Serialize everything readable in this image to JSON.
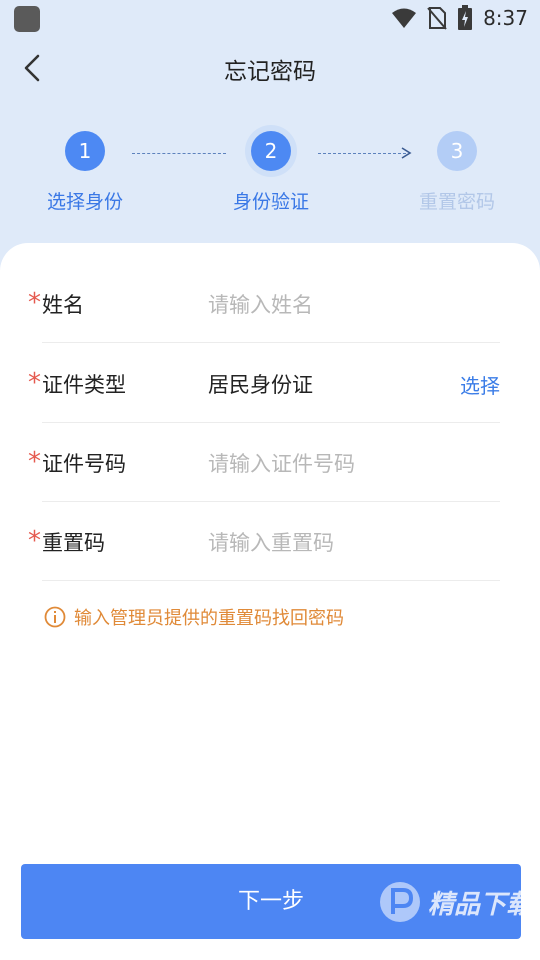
{
  "status_bar": {
    "time": "8:37"
  },
  "header": {
    "title": "忘记密码"
  },
  "stepper": {
    "steps": [
      {
        "num": "1",
        "label": "选择身份"
      },
      {
        "num": "2",
        "label": "身份验证"
      },
      {
        "num": "3",
        "label": "重置密码"
      }
    ]
  },
  "form": {
    "required_mark": "*",
    "fields": [
      {
        "label": "姓名",
        "placeholder": "请输入姓名"
      },
      {
        "label": "证件类型",
        "value": "居民身份证",
        "action": "选择"
      },
      {
        "label": "证件号码",
        "placeholder": "请输入证件号码"
      },
      {
        "label": "重置码",
        "placeholder": "请输入重置码"
      }
    ],
    "hint": "输入管理员提供的重置码找回密码"
  },
  "footer": {
    "next_label": "下一步"
  },
  "watermark": {
    "text": "精品下载"
  },
  "colors": {
    "accent": "#4d86f3",
    "required": "#e55a4f",
    "hint": "#e08a38",
    "header_bg": "#dfeaf9"
  }
}
